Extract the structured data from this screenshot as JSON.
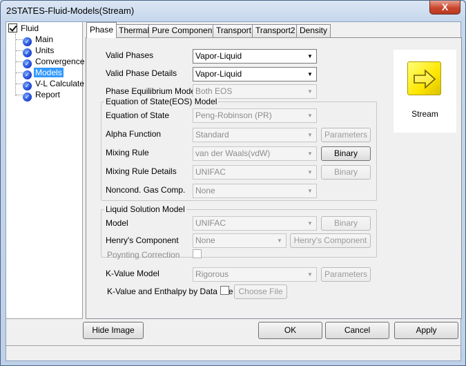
{
  "window": {
    "title": "2STATES-Fluid-Models(Stream)",
    "close_label": "X"
  },
  "tree": {
    "root": "Fluid",
    "items": [
      {
        "label": "Main",
        "icon": "check-circle-icon"
      },
      {
        "label": "Units",
        "icon": "check-circle-icon"
      },
      {
        "label": "Convergence",
        "icon": "check-circle-icon"
      },
      {
        "label": "Models",
        "icon": "check-circle-icon",
        "selected": true
      },
      {
        "label": "V-L Calculate",
        "icon": "check-circle-icon"
      },
      {
        "label": "Report",
        "icon": "check-circle-icon"
      }
    ]
  },
  "tabs": [
    "Phase",
    "Thermal",
    "Pure Component",
    "Transport",
    "Transport2",
    "Density"
  ],
  "active_tab": "Phase",
  "form": {
    "valid_phases": {
      "label": "Valid Phases",
      "value": "Vapor-Liquid"
    },
    "valid_phase_details": {
      "label": "Valid Phase Details",
      "value": "Vapor-Liquid"
    },
    "phase_equilibrium_model": {
      "label": "Phase Equilibrium Model",
      "value": "Both EOS"
    },
    "eos_group": {
      "title": "Equation of State(EOS) Model",
      "equation_of_state": {
        "label": "Equation of State",
        "value": "Peng-Robinson (PR)"
      },
      "alpha_function": {
        "label": "Alpha Function",
        "value": "Standard",
        "button": "Parameters"
      },
      "mixing_rule": {
        "label": "Mixing Rule",
        "value": "van der Waals(vdW)",
        "button": "Binary"
      },
      "mixing_rule_details": {
        "label": "Mixing Rule Details",
        "value": "UNIFAC",
        "button": "Binary"
      },
      "noncond_gas": {
        "label": "Noncond. Gas Comp.",
        "value": "None"
      }
    },
    "liquid_group": {
      "title": "Liquid Solution Model",
      "model": {
        "label": "Model",
        "value": "UNIFAC",
        "button": "Binary"
      },
      "henrys_component": {
        "label": "Henry's Component",
        "value": "None",
        "button": "Henry's Component"
      },
      "poynting_correction": {
        "label": "Poynting Correction"
      }
    },
    "kvalue_model": {
      "label": "K-Value Model",
      "value": "Rigorous",
      "button": "Parameters"
    },
    "kvalue_data_file": {
      "label": "K-Value and Enthalpy by Data File",
      "button": "Choose File"
    }
  },
  "image_panel": {
    "label": "Stream",
    "icon": "stream-arrow-icon"
  },
  "buttons": {
    "hide_image": "Hide Image",
    "ok": "OK",
    "cancel": "Cancel",
    "apply": "Apply"
  }
}
